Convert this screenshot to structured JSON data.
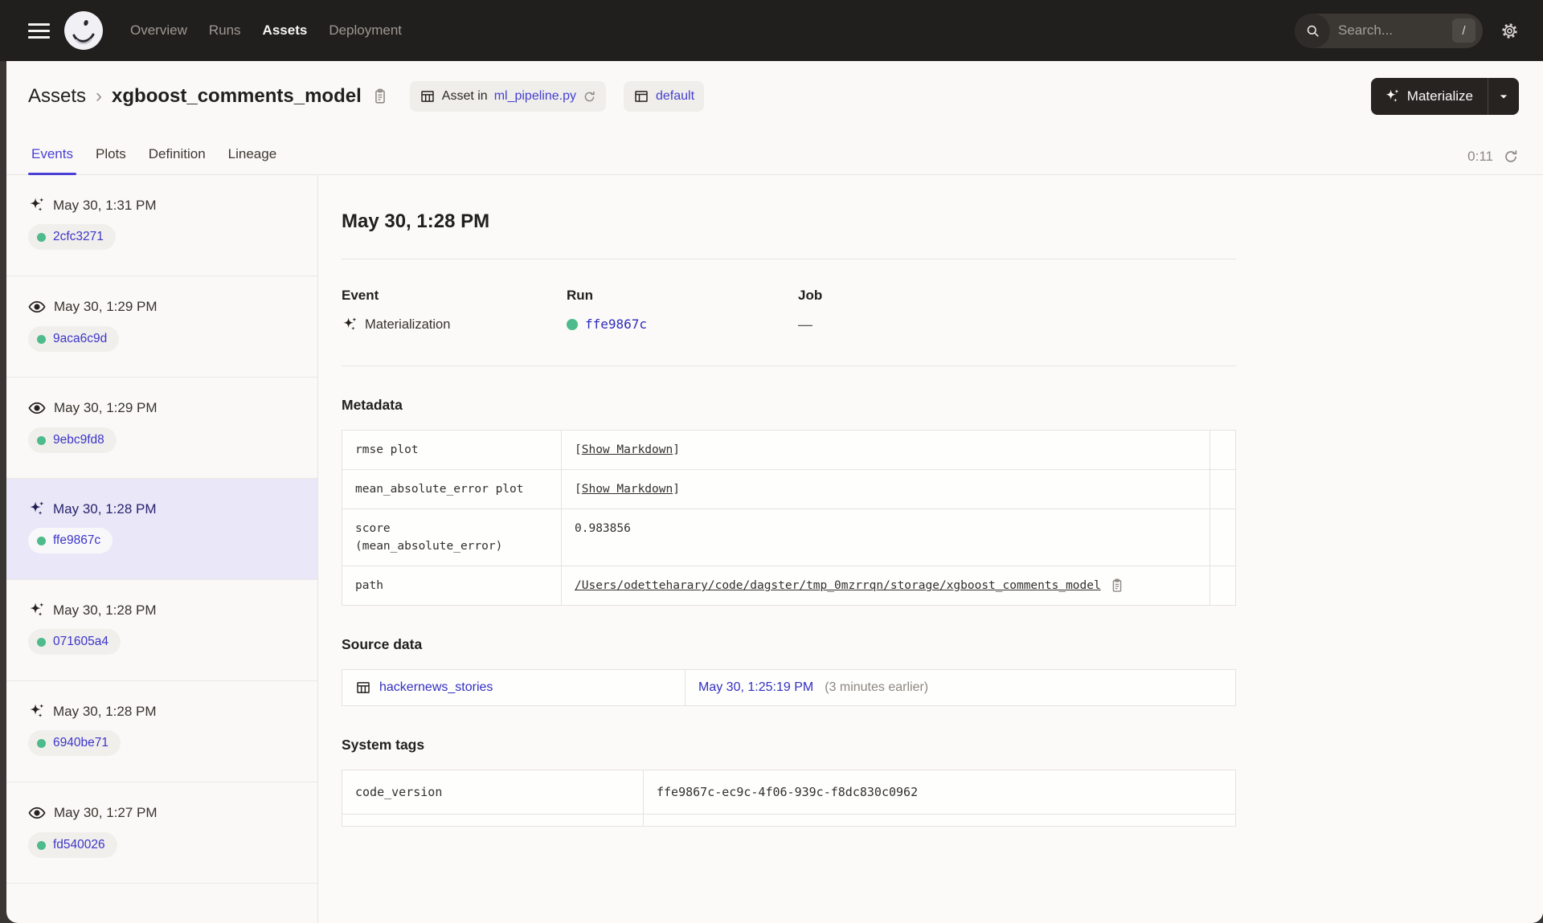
{
  "colors": {
    "nav_bg": "#211F1D",
    "accent": "#4B3FD6",
    "link_blue": "#3B35C9",
    "success_green": "#4DBB8B",
    "selected_bg": "#E9E7F8"
  },
  "nav": {
    "links": [
      {
        "label": "Overview",
        "active": false
      },
      {
        "label": "Runs",
        "active": false
      },
      {
        "label": "Assets",
        "active": true
      },
      {
        "label": "Deployment",
        "active": false
      }
    ],
    "search": {
      "placeholder": "Search...",
      "shortcut": "/"
    }
  },
  "header": {
    "breadcrumb": {
      "root": "Assets",
      "separator": "›",
      "current": "xgboost_comments_model"
    },
    "asset_in_badge": {
      "prefix": "Asset in",
      "file": "ml_pipeline.py"
    },
    "repo_badge": {
      "label": "default"
    },
    "materialize_label": "Materialize"
  },
  "tabs": {
    "items": [
      {
        "label": "Events",
        "active": true
      },
      {
        "label": "Plots",
        "active": false
      },
      {
        "label": "Definition",
        "active": false
      },
      {
        "label": "Lineage",
        "active": false
      }
    ],
    "refresh_timer": "0:11"
  },
  "events": {
    "items": [
      {
        "icon": "materialization-icon",
        "timestamp": "May 30, 1:31 PM",
        "run_id": "2cfc3271",
        "selected": false
      },
      {
        "icon": "observation-icon",
        "timestamp": "May 30, 1:29 PM",
        "run_id": "9aca6c9d",
        "selected": false
      },
      {
        "icon": "observation-icon",
        "timestamp": "May 30, 1:29 PM",
        "run_id": "9ebc9fd8",
        "selected": false
      },
      {
        "icon": "materialization-icon",
        "timestamp": "May 30, 1:28 PM",
        "run_id": "ffe9867c",
        "selected": true
      },
      {
        "icon": "materialization-icon",
        "timestamp": "May 30, 1:28 PM",
        "run_id": "071605a4",
        "selected": false
      },
      {
        "icon": "materialization-icon",
        "timestamp": "May 30, 1:28 PM",
        "run_id": "6940be71",
        "selected": false
      },
      {
        "icon": "observation-icon",
        "timestamp": "May 30, 1:27 PM",
        "run_id": "fd540026",
        "selected": false
      }
    ]
  },
  "detail": {
    "title": "May 30, 1:28 PM",
    "event": {
      "label": "Event",
      "value": "Materialization"
    },
    "run": {
      "label": "Run",
      "value": "ffe9867c"
    },
    "job": {
      "label": "Job",
      "value": "—"
    },
    "metadata": {
      "heading": "Metadata",
      "markdown_open": "[",
      "markdown_label": "Show Markdown",
      "markdown_close": "]",
      "rows": [
        {
          "key": "rmse plot"
        },
        {
          "key": "mean_absolute_error plot"
        },
        {
          "key_line1": "score",
          "key_line2": "(mean_absolute_error)",
          "value": "0.983856"
        },
        {
          "key": "path",
          "value": "/Users/odetteharary/code/dagster/tmp_0mzrrqn/storage/xgboost_comments_model"
        }
      ]
    },
    "source_data": {
      "heading": "Source data",
      "asset": "hackernews_stories",
      "timestamp": "May 30, 1:25:19 PM",
      "relative": "(3 minutes earlier)"
    },
    "system_tags": {
      "heading": "System tags",
      "rows": [
        {
          "key": "code_version",
          "value": "ffe9867c-ec9c-4f06-939c-f8dc830c0962"
        }
      ]
    }
  }
}
